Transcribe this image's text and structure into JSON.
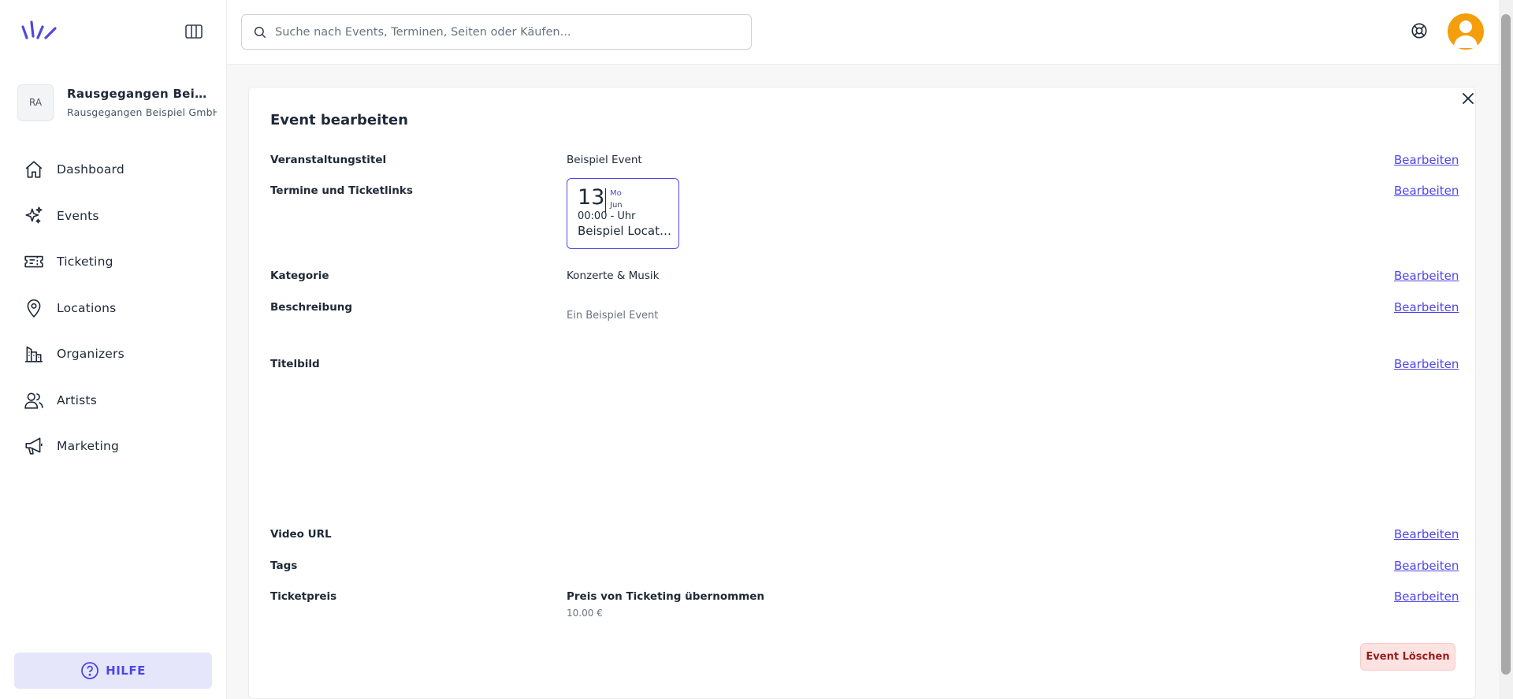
{
  "sidebar": {
    "org": {
      "initials": "RA",
      "name": "Rausgegangen Beispiel Location",
      "subtitle": "Rausgegangen Beispiel GmbH"
    },
    "items": [
      {
        "label": "Dashboard",
        "icon": "home-icon"
      },
      {
        "label": "Events",
        "icon": "sparkles-icon"
      },
      {
        "label": "Ticketing",
        "icon": "ticket-icon"
      },
      {
        "label": "Locations",
        "icon": "map-pin-icon"
      },
      {
        "label": "Organizers",
        "icon": "building-icon"
      },
      {
        "label": "Artists",
        "icon": "users-icon"
      },
      {
        "label": "Marketing",
        "icon": "megaphone-icon"
      }
    ],
    "help_label": "HILFE"
  },
  "search": {
    "placeholder": "Suche nach Events, Terminen, Seiten oder Käufen..."
  },
  "card": {
    "title": "Event bearbeiten",
    "edit_label": "Bearbeiten",
    "rows": {
      "title": {
        "label": "Veranstaltungstitel",
        "value": "Beispiel Event"
      },
      "dates": {
        "label": "Termine und Ticketlinks",
        "date": {
          "day": "13",
          "weekday": "Mo",
          "month": "Jun",
          "time": "00:00 - Uhr",
          "location": "Beispiel Location"
        }
      },
      "category": {
        "label": "Kategorie",
        "value": "Konzerte & Musik"
      },
      "description": {
        "label": "Beschreibung",
        "value": "Ein Beispiel Event"
      },
      "image": {
        "label": "Titelbild"
      },
      "video": {
        "label": "Video URL"
      },
      "tags": {
        "label": "Tags"
      },
      "price": {
        "label": "Ticketpreis",
        "value": "Preis von Ticketing übernommen",
        "sub": "10.00 €"
      }
    },
    "delete_label": "Event Löschen"
  },
  "colors": {
    "accent": "#4f46e5",
    "avatar": "#f59e0b",
    "danger_bg": "#fde2e2",
    "danger_text": "#9b1c1c"
  }
}
